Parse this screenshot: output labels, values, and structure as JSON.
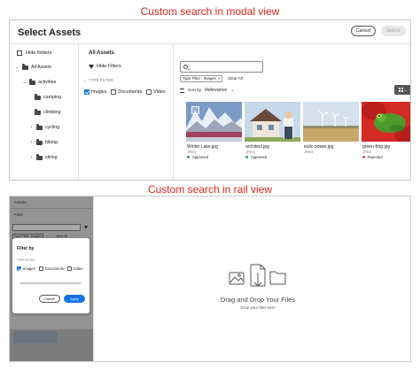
{
  "captions": {
    "modal": "Custom search in modal view",
    "rail": "Custom search in rail view"
  },
  "modal": {
    "title": "Select Assets",
    "cancel_label": "Cancel",
    "select_label": "Select",
    "hide_folders": "Hide folders",
    "tree": {
      "root": "All Assets",
      "items": [
        "activities",
        "camping",
        "climbing",
        "cycling",
        "hiking",
        "skiing"
      ]
    },
    "filters": {
      "heading": "All Assets",
      "hide_filters": "Hide Filters",
      "type_filter_label": "TYPE FILTER",
      "checkboxes": [
        {
          "label": "Images",
          "checked": true
        },
        {
          "label": "Documents",
          "checked": false
        },
        {
          "label": "Video",
          "checked": false
        }
      ]
    },
    "results": {
      "tag": "Type Filter : Images",
      "tag_close": "×",
      "clear_all": "Clear All",
      "sort_label": "Sort by",
      "sort_value": "Relevance",
      "assets": [
        {
          "name": "Winter Lake.jpg",
          "type": "JPEG",
          "status": "Approved",
          "status_color": "#2d9d78"
        },
        {
          "name": "architect.jpg",
          "type": "JPEG",
          "status": "Approved",
          "status_color": "#2d9d78"
        },
        {
          "name": "eolic-power.jpg",
          "type": "JPEG",
          "status": "",
          "status_color": ""
        },
        {
          "name": "green-frog.jpg",
          "type": "JPEG",
          "status": "Rejected",
          "status_color": "#e34850"
        }
      ]
    }
  },
  "rail": {
    "title": "Assets",
    "files_label": "Files",
    "tag": "Type Filter : Images",
    "clear_all": "Clear All",
    "filter_by": "Filter by",
    "type_filter_label": "TYPE FILTER",
    "checkboxes": [
      {
        "label": "Images",
        "checked": true
      },
      {
        "label": "Documents",
        "checked": false
      },
      {
        "label": "Video",
        "checked": false
      }
    ],
    "cancel_label": "Cancel",
    "apply_label": "Apply"
  },
  "dropzone": {
    "title": "Drag and Drop Your Files",
    "subtitle": "Drop your files here"
  },
  "colors": {
    "caption_red": "#e0241b",
    "accent_blue": "#1473e6",
    "approved_green": "#2d9d78",
    "rejected_red": "#e34850"
  }
}
